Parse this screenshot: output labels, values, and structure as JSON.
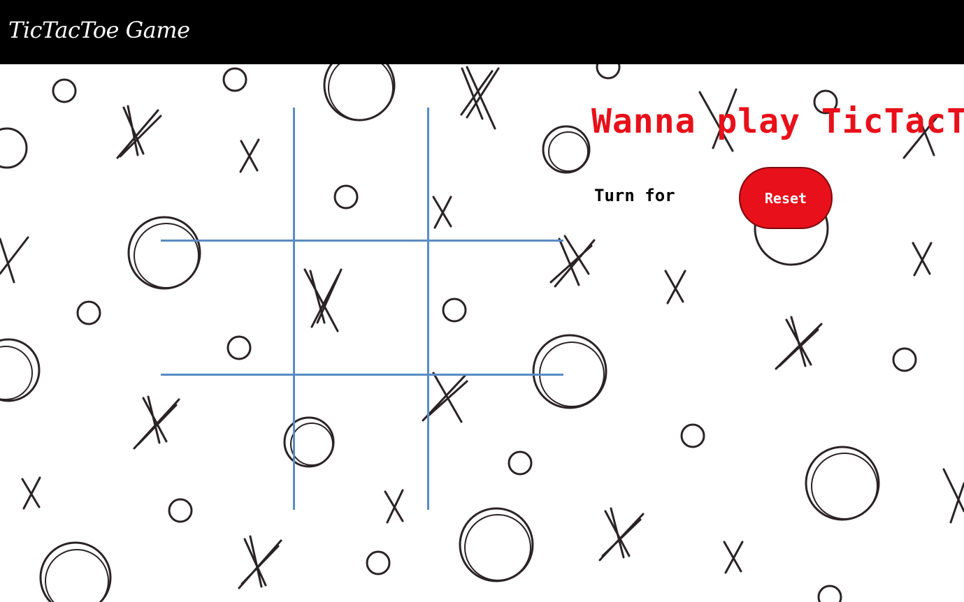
{
  "navbar": {
    "brand": "TicTacToe Game"
  },
  "info": {
    "headline": "Wanna play TicTacToe?",
    "turn_label": "Turn for",
    "reset_label": "Reset"
  },
  "board": {
    "cells": [
      "",
      "",
      "",
      "",
      "",
      "",
      "",
      "",
      ""
    ]
  },
  "colors": {
    "navbar_bg": "#000000",
    "accent_red": "#e8101a",
    "grid_line": "#5a8bc4",
    "pattern_stroke": "#2a2325"
  },
  "icons": [
    "x-doodle-icon",
    "o-doodle-icon"
  ]
}
